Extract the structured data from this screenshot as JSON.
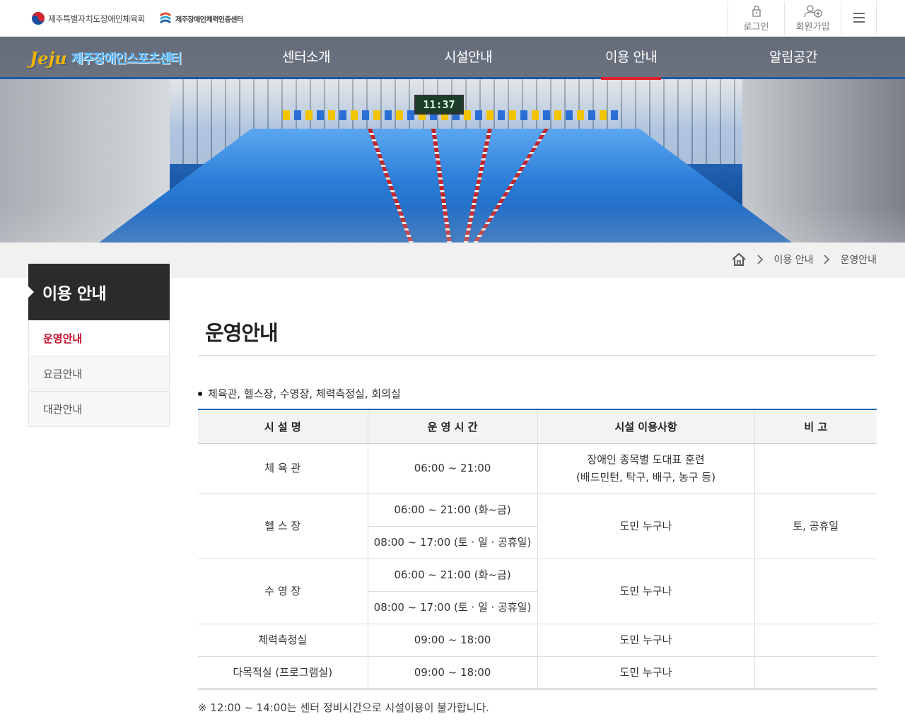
{
  "top_bar": {
    "org1": "제주특별자치도장애인체육회",
    "org2": "제주장애인체력인증센터",
    "login": "로그인",
    "join": "회원가입"
  },
  "logo": {
    "script": "Jeju",
    "name": "제주장애인스포츠센터"
  },
  "nav": [
    "센터소개",
    "시설안내",
    "이용 안내",
    "알림공간"
  ],
  "nav_active": "이용 안내",
  "hero": {
    "clock": "11:37"
  },
  "breadcrumb": [
    "이용 안내",
    "운영안내"
  ],
  "sidebar": {
    "title": "이용 안내",
    "items": [
      {
        "label": "운영안내",
        "active": true
      },
      {
        "label": "요금안내",
        "active": false
      },
      {
        "label": "대관안내",
        "active": false
      }
    ]
  },
  "main": {
    "title": "운영안내",
    "bullet": "체육관, 헬스장, 수영장, 체력측정실, 회의실",
    "table": {
      "headers": [
        "시 설 명",
        "운 영 시 간",
        "시설 이용사항",
        "비 고"
      ],
      "rows": {
        "gym": {
          "name": "체 육 관",
          "time": "06:00 ~ 21:00",
          "usage1": "장애인 종목별 도대표 훈련",
          "usage2": "(배드민턴, 탁구, 배구, 농구 등)",
          "note": ""
        },
        "fitness": {
          "name": "헬 스 장",
          "time1": "06:00 ~ 21:00 (화~금)",
          "time2": "08:00 ~ 17:00 (토 · 일 · 공휴일)",
          "usage": "도민 누구나",
          "note": "토, 공휴일"
        },
        "pool": {
          "name": "수 영 장",
          "time1": "06:00 ~ 21:00 (화~금)",
          "time2": "08:00 ~ 17:00 (토 · 일 · 공휴일)",
          "usage": "도민 누구나",
          "note": ""
        },
        "measure": {
          "name": "체력측정실",
          "time": "09:00 ~ 18:00",
          "usage": "도민 누구나",
          "note": ""
        },
        "program": {
          "name": "다목적실 (프로그램실)",
          "time": "09:00 ~ 18:00",
          "usage": "도민 누구나",
          "note": ""
        }
      }
    },
    "footnote": "※ 12:00 ~ 14:00는 센터 정비시간으로 시설이용이 불가합니다."
  },
  "colors": {
    "accent_red": "#c8102e",
    "nav_underline": "#e5202e",
    "table_top": "#1d6cb8",
    "sidebar_dark": "#2b2b2b"
  },
  "icons": [
    "lock-icon",
    "user-add-icon",
    "hamburger-menu-icon",
    "home-icon",
    "chevron-right-icon"
  ]
}
